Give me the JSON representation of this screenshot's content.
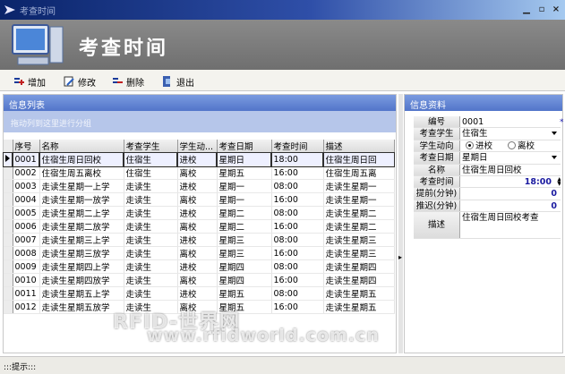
{
  "window": {
    "title": "考查时间"
  },
  "banner": {
    "title": "考查时间"
  },
  "toolbar": {
    "add_label": "增加",
    "edit_label": "修改",
    "delete_label": "删除",
    "exit_label": "退出"
  },
  "list_panel": {
    "title": "信息列表",
    "group_hint": "拖动列到这里进行分组",
    "columns": [
      "序号",
      "名称",
      "考查学生",
      "学生动...",
      "考查日期",
      "考查时间",
      "描述"
    ],
    "rows": [
      [
        "0001",
        "住宿生周日回校",
        "住宿生",
        "进校",
        "星期日",
        "18:00",
        "住宿生周日回"
      ],
      [
        "0002",
        "住宿生周五离校",
        "住宿生",
        "离校",
        "星期五",
        "16:00",
        "住宿生周五离"
      ],
      [
        "0003",
        "走读生星期一上学",
        "走读生",
        "进校",
        "星期一",
        "08:00",
        "走读生星期一"
      ],
      [
        "0004",
        "走读生星期一放学",
        "走读生",
        "离校",
        "星期一",
        "16:00",
        "走读生星期一"
      ],
      [
        "0005",
        "走读生星期二上学",
        "走读生",
        "进校",
        "星期二",
        "08:00",
        "走读生星期二"
      ],
      [
        "0006",
        "走读生星期二放学",
        "走读生",
        "离校",
        "星期二",
        "16:00",
        "走读生星期二"
      ],
      [
        "0007",
        "走读生星期三上学",
        "走读生",
        "进校",
        "星期三",
        "08:00",
        "走读生星期三"
      ],
      [
        "0008",
        "走读生星期三放学",
        "走读生",
        "离校",
        "星期三",
        "16:00",
        "走读生星期三"
      ],
      [
        "0009",
        "走读生星期四上学",
        "走读生",
        "进校",
        "星期四",
        "08:00",
        "走读生星期四"
      ],
      [
        "0010",
        "走读生星期四放学",
        "走读生",
        "离校",
        "星期四",
        "16:00",
        "走读生星期四"
      ],
      [
        "0011",
        "走读生星期五上学",
        "走读生",
        "进校",
        "星期五",
        "08:00",
        "走读生星期五"
      ],
      [
        "0012",
        "走读生星期五放学",
        "走读生",
        "离校",
        "星期五",
        "16:00",
        "走读生星期五"
      ]
    ]
  },
  "detail_panel": {
    "title": "信息资料",
    "code_label": "编号",
    "code_value": "0001",
    "student_label": "考查学生",
    "student_value": "住宿生",
    "direction_label": "学生动向",
    "direction_in": "进校",
    "direction_out": "离校",
    "date_label": "考查日期",
    "date_value": "星期日",
    "name_label": "名称",
    "name_value": "住宿生周日回校",
    "time_label": "考查时间",
    "time_value": "18:00",
    "early_label": "提前(分钟)",
    "early_value": "0",
    "late_label": "推迟(分钟)",
    "late_value": "0",
    "desc_label": "描述",
    "desc_value": "住宿生周日回校考查"
  },
  "status": {
    "hint": ":::提示:::"
  },
  "watermark": {
    "line1": "RFID-世界网",
    "line2": "www.rfidworld.com.cn"
  }
}
